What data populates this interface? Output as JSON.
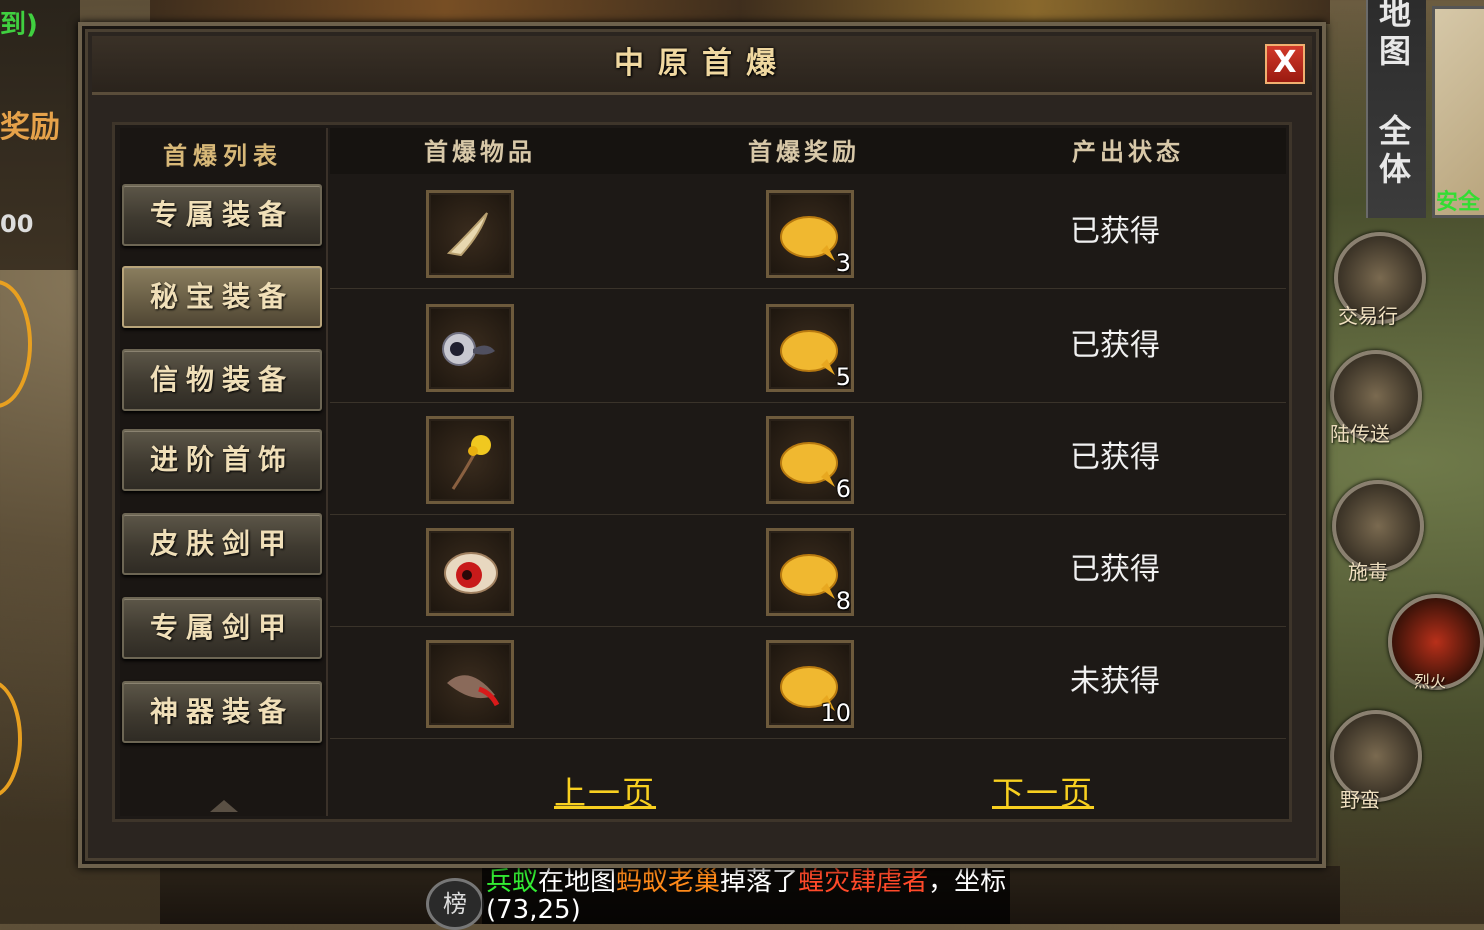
{
  "background": {
    "fragments": [
      "到)",
      "奖励",
      "00"
    ],
    "side_buttons": [
      "地图",
      "全体"
    ],
    "minimap_label": "安全",
    "round_icons": [
      "交易行",
      "陆传送",
      "施毒",
      "烈火",
      "野蛮"
    ],
    "rank_label": "榜",
    "chat": {
      "p1": "兵蚁",
      "p2": "在地图",
      "p3": "蚂蚁老巢",
      "p4": "掉落了",
      "p5": "蝗灾肆虐者",
      "p6": "，坐标(73,25)"
    }
  },
  "dialog": {
    "title": "中原首爆",
    "close_label": "X",
    "list_header": "首爆列表",
    "categories": [
      "专属装备",
      "秘宝装备",
      "信物装备",
      "进阶首饰",
      "皮肤剑甲",
      "专属剑甲",
      "神器装备"
    ],
    "active_category": 1,
    "columns": [
      "首爆物品",
      "首爆奖励",
      "产出状态"
    ],
    "rows": [
      {
        "item_icon": "claw-icon",
        "reward_icon": "gold-leaf-icon",
        "reward_count": "3",
        "status": "已获得"
      },
      {
        "item_icon": "eyeball-icon",
        "reward_icon": "gold-leaf-icon",
        "reward_count": "5",
        "status": "已获得"
      },
      {
        "item_icon": "golden-flower-icon",
        "reward_icon": "gold-leaf-icon",
        "reward_count": "6",
        "status": "已获得"
      },
      {
        "item_icon": "red-eye-icon",
        "reward_icon": "gold-leaf-icon",
        "reward_count": "8",
        "status": "已获得"
      },
      {
        "item_icon": "feather-icon",
        "reward_icon": "gold-leaf-icon",
        "reward_count": "10",
        "status": "未获得"
      }
    ],
    "prev_page": "上一页",
    "next_page": "下一页"
  }
}
